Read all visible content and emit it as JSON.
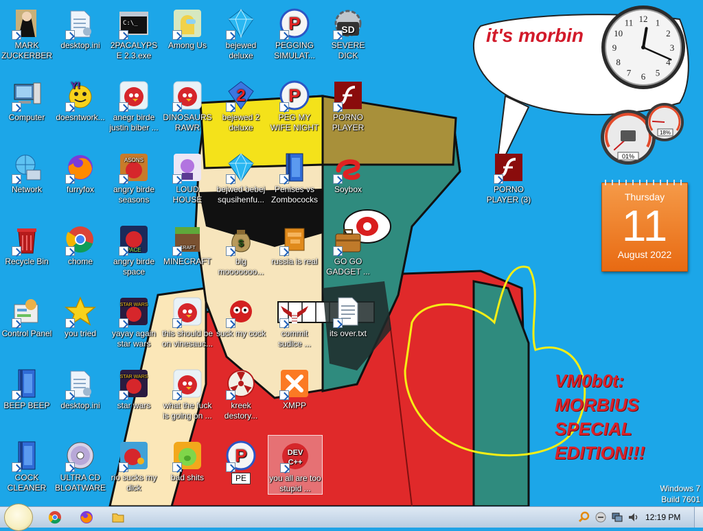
{
  "desktop": {
    "icons": [
      {
        "label": "MARK ZUCKERBERG",
        "icon": "mark-zuckerberg-icon"
      },
      {
        "label": "desktop.ini",
        "icon": "ini-file-icon"
      },
      {
        "label": "2PACALYPSE 2.3.exe",
        "icon": "console-icon"
      },
      {
        "label": "Among Us",
        "icon": "among-us-icon"
      },
      {
        "label": "bejewed deluxe",
        "icon": "gem-icon"
      },
      {
        "label": "PEGGING SIMULAT...",
        "icon": "p-logo-icon"
      },
      {
        "label": "SEVERE DICK",
        "icon": "sd-gear-icon"
      },
      {
        "label": "Computer",
        "icon": "computer-icon"
      },
      {
        "label": "doesntwork...",
        "icon": "yahoo-messenger-icon"
      },
      {
        "label": "anegr birde justin biber ...",
        "icon": "angry-bird-icon"
      },
      {
        "label": "DINOSAURS RAWR",
        "icon": "angry-bird-icon"
      },
      {
        "label": "bejewed 2 deluxe",
        "icon": "gem-2-icon"
      },
      {
        "label": "PEG MY WIFE NIGHT",
        "icon": "p-logo-icon"
      },
      {
        "label": "PORNO PLAYER",
        "icon": "flash-icon"
      },
      {
        "label": "Network",
        "icon": "network-globe-icon"
      },
      {
        "label": "furryfox",
        "icon": "firefox-icon"
      },
      {
        "label": "angry birde seasons",
        "icon": "angry-birds-seasons-icon"
      },
      {
        "label": "LOUD HOUSE",
        "icon": "loud-house-icon"
      },
      {
        "label": "bejwed bebej squsihenfu...",
        "icon": "gem-icon"
      },
      {
        "label": "Penises vs Zombococks",
        "icon": "blue-book-icon"
      },
      {
        "label": "Soybox",
        "icon": "soybox-icon"
      },
      {
        "label": "PORNO PLAYER (3)",
        "icon": "flash-icon"
      },
      {
        "label": "Recycle Bin",
        "icon": "recycle-bin-icon"
      },
      {
        "label": "chome",
        "icon": "chrome-icon"
      },
      {
        "label": "angry birde space",
        "icon": "angry-birds-space-icon"
      },
      {
        "label": "MINECRAFT",
        "icon": "minecraft-icon"
      },
      {
        "label": "big mooooooo...",
        "icon": "money-bag-icon"
      },
      {
        "label": "russia is real",
        "icon": "orange-box-icon"
      },
      {
        "label": "GO GO GADGET ...",
        "icon": "briefcase-icon"
      },
      {
        "label": "Control Panel",
        "icon": "control-panel-icon"
      },
      {
        "label": "you tried",
        "icon": "gold-star-icon"
      },
      {
        "label": "yayay again star wars",
        "icon": "angry-birds-star-wars-icon"
      },
      {
        "label": "this should be on vinesauc...",
        "icon": "angry-bird-icon"
      },
      {
        "label": "suck my cock",
        "icon": "red-creature-icon"
      },
      {
        "label": "commit sudice ...",
        "icon": "eagle-emblem-icon"
      },
      {
        "label": "its over.txt",
        "icon": "text-file-icon"
      },
      {
        "label": "BEEP BEEP",
        "icon": "blue-book-icon"
      },
      {
        "label": "desktop.ini",
        "icon": "ini-file-icon"
      },
      {
        "label": "star wars",
        "icon": "angry-birds-star-wars-icon"
      },
      {
        "label": "what the fuck is going on ...",
        "icon": "angry-bird-icon"
      },
      {
        "label": "kreek destory...",
        "icon": "radiation-icon"
      },
      {
        "label": "XMPP",
        "icon": "xampp-icon"
      },
      {
        "label": "COCK CLEANER",
        "icon": "blue-book-icon"
      },
      {
        "label": "ULTRA CD BLOATWARE",
        "icon": "cd-disc-icon"
      },
      {
        "label": "rio sucks my dick",
        "icon": "angry-birds-rio-icon"
      },
      {
        "label": "bad shits",
        "icon": "bad-piggies-icon"
      },
      {
        "label": "",
        "icon": "p-logo-icon",
        "rename_value": "PE"
      },
      {
        "label": "you all are too stupid ...",
        "icon": "dev-cpp-icon",
        "selected": true
      }
    ],
    "wallpaper_texts": {
      "bubble": "it's morbin",
      "vm_lines": [
        "VM0b0t:",
        "MORBIUS",
        "SPECIAL",
        "EDITION!!!"
      ]
    },
    "watermark": {
      "line1": "Windows 7",
      "line2": "Build 7601"
    }
  },
  "gadgets": {
    "clock": {
      "hour": 12,
      "minute": 19
    },
    "cpu_meter": {
      "cpu_percent": 1,
      "cpu_label": "01%",
      "ram_percent": 18,
      "ram_label": "18%"
    },
    "calendar": {
      "weekday": "Thursday",
      "day": "11",
      "month_year": "August 2022"
    }
  },
  "taskbar": {
    "pinned": [
      "chrome-icon",
      "firefox-icon",
      "folder-icon"
    ],
    "tray": [
      "search-icon",
      "messenger-icon",
      "network-icon",
      "volume-icon"
    ],
    "time": "12:19 PM"
  },
  "colors": {
    "desktop_bg": "#1ca6e8",
    "calendar": "#e86a12",
    "wallpaper_text": "#d8232b"
  }
}
